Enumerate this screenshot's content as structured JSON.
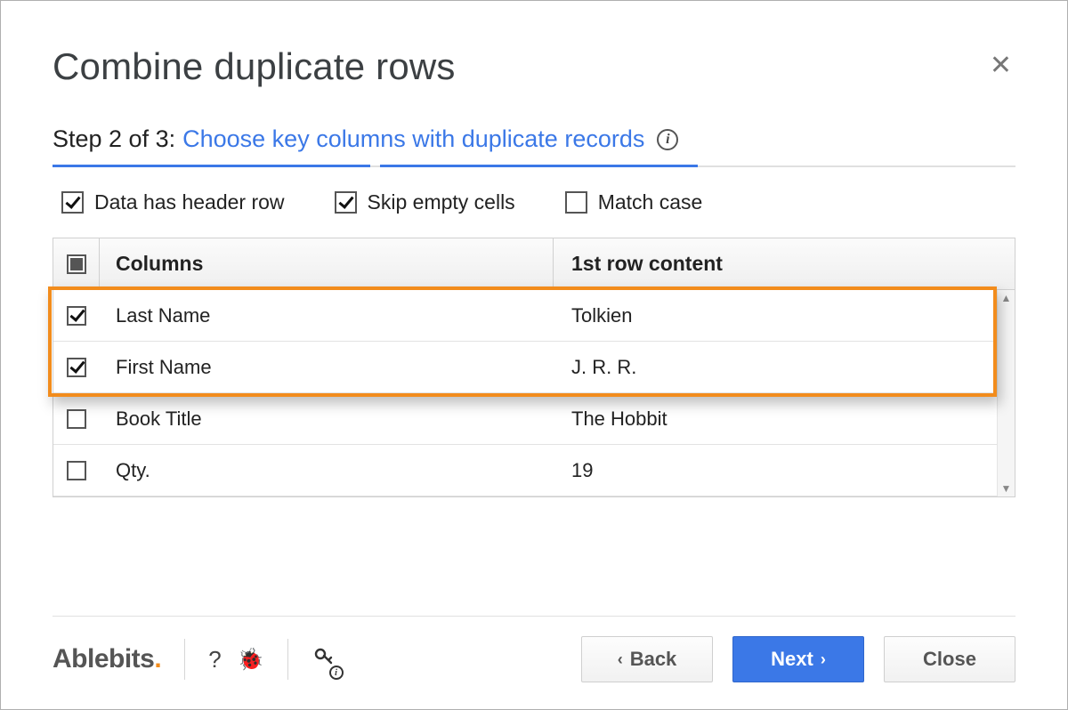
{
  "dialog": {
    "title": "Combine duplicate rows",
    "close_symbol": "✕"
  },
  "step": {
    "prefix": "Step 2 of 3:",
    "description": "Choose key columns with duplicate records",
    "info_symbol": "i",
    "progress": {
      "seg1_left_pct": 0,
      "seg1_width_pct": 33,
      "seg2_left_pct": 34,
      "seg2_width_pct": 33
    }
  },
  "options": {
    "header_row": {
      "label": "Data has header row",
      "checked": true
    },
    "skip_empty": {
      "label": "Skip empty cells",
      "checked": true
    },
    "match_case": {
      "label": "Match case",
      "checked": false
    }
  },
  "table": {
    "header": {
      "col1": "Columns",
      "col2": "1st row content"
    },
    "rows": [
      {
        "checked": true,
        "column": "Last Name",
        "first_row": "Tolkien"
      },
      {
        "checked": true,
        "column": "First Name",
        "first_row": "J. R. R."
      },
      {
        "checked": false,
        "column": "Book Title",
        "first_row": "The Hobbit"
      },
      {
        "checked": false,
        "column": "Qty.",
        "first_row": "19"
      }
    ],
    "highlight_first_n": 2,
    "scroll": {
      "up": "▲",
      "down": "▼"
    }
  },
  "footer": {
    "brand": "Ablebits",
    "help_symbol": "?",
    "bug_symbol": "🐞",
    "key_symbol": "🔑",
    "key_info_symbol": "i",
    "buttons": {
      "back": "Back",
      "next": "Next",
      "close": "Close",
      "back_chevron": "‹",
      "next_chevron": "›"
    }
  }
}
